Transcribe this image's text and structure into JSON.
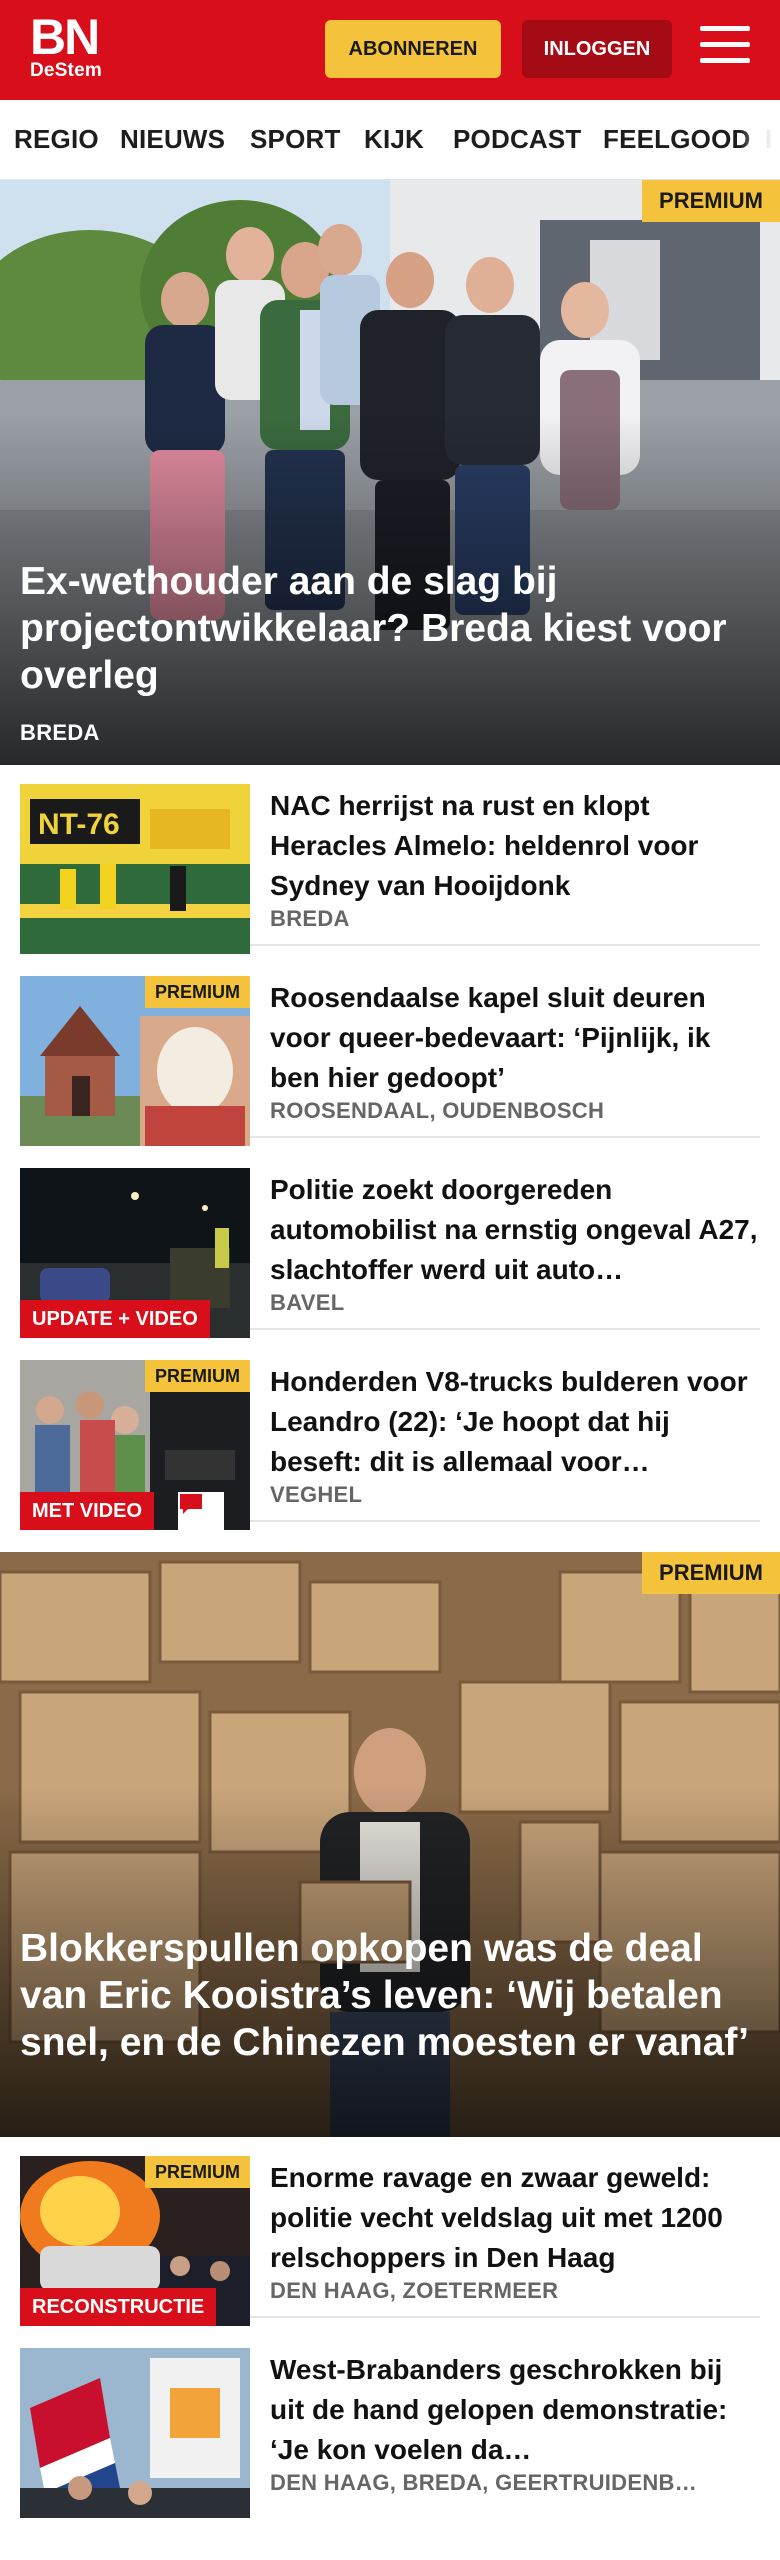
{
  "brand": {
    "logo_main": "BN",
    "logo_sub": "DeStem",
    "color": "#d80f1a"
  },
  "header": {
    "subscribe_label": "ABONNEREN",
    "login_label": "INLOGGEN"
  },
  "nav": {
    "items": [
      "REGIO",
      "NIEUWS",
      "SPORT",
      "KIJK",
      "PODCAST",
      "FEELGOOD",
      "I"
    ]
  },
  "hero1": {
    "badge": "PREMIUM",
    "title": "Ex-wethouder aan de slag bij projectontwikkelaar? Breda kiest voor overleg",
    "location": "BREDA"
  },
  "articles": [
    {
      "title": "NAC herrijst na rust en klopt Heracles Almelo: heldenrol voor Sydney van Hooijdonk",
      "location": "BREDA",
      "premium": "",
      "label": ""
    },
    {
      "title": "Roosendaalse kapel sluit deuren voor queer-bedevaart: ‘Pijnlijk, ik ben hier gedoopt’",
      "location": "ROOSENDAAL, OUDENBOSCH",
      "premium": "PREMIUM",
      "label": ""
    },
    {
      "title": "Politie zoekt doorgereden automobilist na ernstig ongeval A27, slachtoffer werd uit auto…",
      "location": "BAVEL",
      "premium": "",
      "label": "UPDATE + VIDEO"
    },
    {
      "title": "Honderden V8-trucks bulderen voor Leandro (22): ‘Je hoopt dat hij beseft: dit is allemaal voor…",
      "location": "VEGHEL",
      "premium": "PREMIUM",
      "label": "MET VIDEO"
    }
  ],
  "hero2": {
    "badge": "PREMIUM",
    "title": "Blokkerspullen opkopen was de deal van Eric Kooistra’s leven: ‘Wij betalen snel, en de Chinezen moesten er vanaf’"
  },
  "articles2": [
    {
      "title": "Enorme ravage en zwaar geweld: politie vecht veldslag uit met 1200 relschoppers in Den Haag",
      "location": "DEN HAAG, ZOETERMEER",
      "premium": "PREMIUM",
      "label": "RECONSTRUCTIE"
    },
    {
      "title": "West-Brabanders geschrokken bij uit de hand gelopen demonstratie: ‘Je kon voelen da…",
      "location": "DEN HAAG, BREDA, GEERTRUIDENB…",
      "premium": "",
      "label": ""
    }
  ]
}
